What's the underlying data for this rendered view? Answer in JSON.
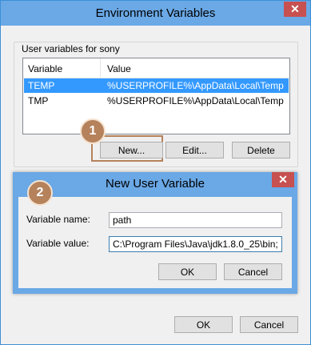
{
  "window": {
    "title": "Environment Variables",
    "close_glyph": "✕"
  },
  "user_vars": {
    "group_label": "User variables for sony",
    "columns": [
      "Variable",
      "Value"
    ],
    "rows": [
      {
        "variable": "TEMP",
        "value": "%USERPROFILE%\\AppData\\Local\\Temp",
        "selected": true
      },
      {
        "variable": "TMP",
        "value": "%USERPROFILE%\\AppData\\Local\\Temp",
        "selected": false
      }
    ],
    "buttons": {
      "new": "New...",
      "edit": "Edit...",
      "delete": "Delete"
    }
  },
  "markers": {
    "one": "1",
    "two": "2"
  },
  "dialog": {
    "title": "New User Variable",
    "close_glyph": "✕",
    "name_label": "Variable name:",
    "name_value": "path",
    "value_label": "Variable value:",
    "value_value": "C:\\Program Files\\Java\\jdk1.8.0_25\\bin;",
    "ok": "OK",
    "cancel": "Cancel"
  },
  "footer": {
    "ok": "OK",
    "cancel": "Cancel"
  },
  "colors": {
    "titlebar": "#6aa8e6",
    "close_button": "#c75050",
    "selection": "#3399ff",
    "annotation": "#b5825c"
  }
}
